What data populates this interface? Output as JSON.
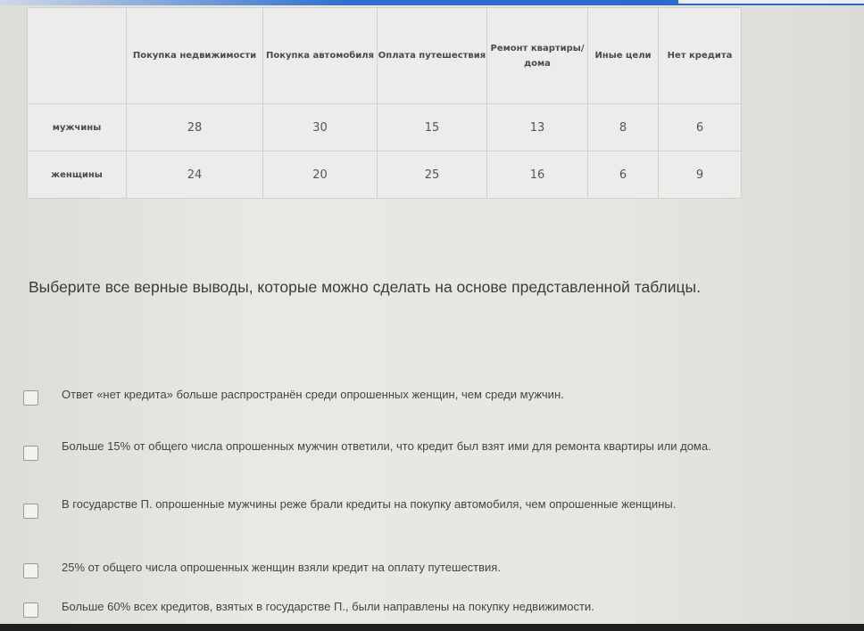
{
  "table": {
    "headers": [
      "",
      "Покупка недвижимости",
      "Покупка автомобиля",
      "Оплата путешествия",
      "Ремонт квартиры/ дома",
      "Иные цели",
      "Нет кредита"
    ],
    "rows": [
      {
        "label": "мужчины",
        "values": [
          "28",
          "30",
          "15",
          "13",
          "8",
          "6"
        ]
      },
      {
        "label": "женщины",
        "values": [
          "24",
          "20",
          "25",
          "16",
          "6",
          "9"
        ]
      }
    ]
  },
  "question": "Выберите все верные выводы, которые можно сделать на основе представленной таблицы.",
  "options": [
    {
      "text": "Ответ «нет кредита» больше распространён среди опрошенных женщин, чем среди мужчин.",
      "checked": false
    },
    {
      "text": "Больше 15% от общего числа опрошенных мужчин ответили, что кредит был взят ими для ремонта квартиры или дома.",
      "checked": false
    },
    {
      "text": "В государстве П. опрошенные мужчины реже брали кредиты на покупку автомобиля, чем опрошенные женщины.",
      "checked": false
    },
    {
      "text": "25% от общего числа опрошенных женщин взяли кредит на оплату путешествия.",
      "checked": false
    },
    {
      "text": "Больше 60% всех кредитов, взятых в государстве П., были направлены на покупку недвижимости.",
      "checked": false
    }
  ],
  "colors": {
    "accent": "#2a67cc"
  }
}
